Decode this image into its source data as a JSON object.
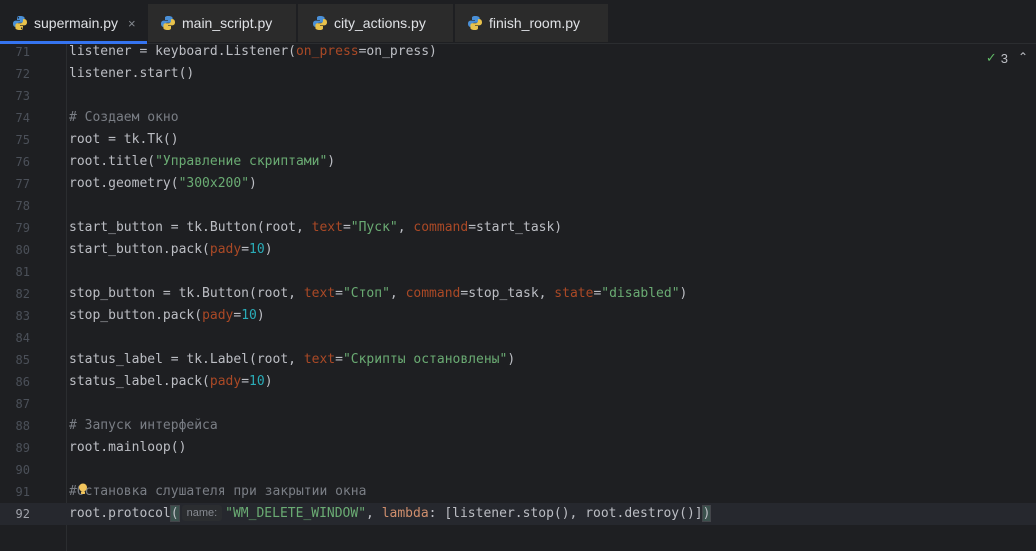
{
  "tabs": [
    {
      "label": "supermain.py",
      "active": true,
      "close": "×"
    },
    {
      "label": "main_script.py",
      "active": false
    },
    {
      "label": "city_actions.py",
      "active": false
    },
    {
      "label": "finish_room.py",
      "active": false
    }
  ],
  "inspection": {
    "count": "3",
    "check": "✓",
    "chevron": "⌃"
  },
  "colors": {
    "accent": "#3574f0",
    "background": "#1e1f22",
    "string": "#6aab73",
    "keyword_arg": "#aa4926",
    "number": "#2aacb8",
    "comment": "#7a7e85"
  },
  "current_line": "92",
  "lines": [
    {
      "n": "71"
    },
    {
      "n": "72"
    },
    {
      "n": "73"
    },
    {
      "n": "74"
    },
    {
      "n": "75"
    },
    {
      "n": "76"
    },
    {
      "n": "77"
    },
    {
      "n": "78"
    },
    {
      "n": "79"
    },
    {
      "n": "80"
    },
    {
      "n": "81"
    },
    {
      "n": "82"
    },
    {
      "n": "83"
    },
    {
      "n": "84"
    },
    {
      "n": "85"
    },
    {
      "n": "86"
    },
    {
      "n": "87"
    },
    {
      "n": "88"
    },
    {
      "n": "89"
    },
    {
      "n": "90"
    },
    {
      "n": "91"
    },
    {
      "n": "92"
    }
  ],
  "code": {
    "l71": [
      "listener = keyboard.Listener(",
      "on_press",
      "=on_press)"
    ],
    "l72": "listener.start()",
    "l74": "# Создаем окно",
    "l75": "root = tk.Tk()",
    "l76": [
      "root.title(",
      "\"Управление скриптами\"",
      ")"
    ],
    "l77": [
      "root.geometry(",
      "\"300x200\"",
      ")"
    ],
    "l79": [
      "start_button = tk.Button(root, ",
      "text",
      "=",
      "\"Пуск\"",
      ", ",
      "command",
      "=start_task)"
    ],
    "l80": [
      "start_button.pack(",
      "pady",
      "=",
      "10",
      ")"
    ],
    "l82": [
      "stop_button = tk.Button(root, ",
      "text",
      "=",
      "\"Стоп\"",
      ", ",
      "command",
      "=stop_task, ",
      "state",
      "=",
      "\"disabled\"",
      ")"
    ],
    "l83": [
      "stop_button.pack(",
      "pady",
      "=",
      "10",
      ")"
    ],
    "l85": [
      "status_label = tk.Label(root, ",
      "text",
      "=",
      "\"Скрипты остановлены\"",
      ")"
    ],
    "l86": [
      "status_label.pack(",
      "pady",
      "=",
      "10",
      ")"
    ],
    "l88": "# Запуск интерфейса",
    "l89": "root.mainloop()",
    "l91": "#Остановка слушателя при закрытии окна",
    "l92": [
      "root.protocol",
      "(",
      "name:",
      "\"WM_DELETE_WINDOW\"",
      ", ",
      "lambda",
      ": [listener.stop(), root.destroy()]",
      ")"
    ]
  }
}
